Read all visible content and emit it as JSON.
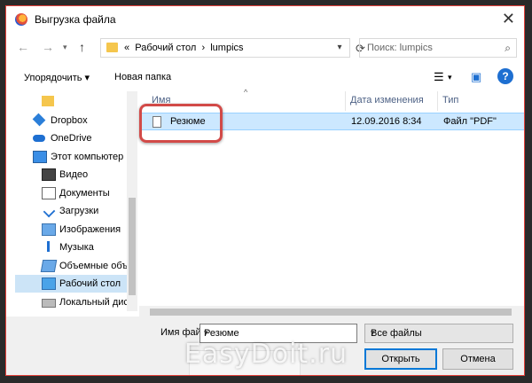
{
  "window": {
    "title": "Выгрузка файла",
    "close_glyph": "✕"
  },
  "address": {
    "path_prefix": "«",
    "crumbs": [
      "Рабочий стол",
      "lumpics"
    ],
    "separator": "›",
    "search_placeholder": "Поиск: lumpics"
  },
  "toolbar": {
    "organize_label": "Упорядочить ▾",
    "new_folder_label": "Новая папка",
    "help_glyph": "?"
  },
  "sidebar": {
    "items": [
      {
        "label": "",
        "icon": "folder-icon",
        "indent": 30
      },
      {
        "label": "Dropbox",
        "icon": "dropbox-icon",
        "indent": 20
      },
      {
        "label": "OneDrive",
        "icon": "onedrive-icon",
        "indent": 20
      },
      {
        "label": "Этот компьютер",
        "icon": "computer-icon",
        "indent": 20
      },
      {
        "label": "Видео",
        "icon": "video-icon",
        "indent": 30
      },
      {
        "label": "Документы",
        "icon": "documents-icon",
        "indent": 30
      },
      {
        "label": "Загрузки",
        "icon": "downloads-icon",
        "indent": 30
      },
      {
        "label": "Изображения",
        "icon": "pictures-icon",
        "indent": 30
      },
      {
        "label": "Музыка",
        "icon": "music-icon",
        "indent": 30
      },
      {
        "label": "Объемные объ",
        "icon": "3d-objects-icon",
        "indent": 30
      },
      {
        "label": "Рабочий стол",
        "icon": "desktop-icon",
        "indent": 30,
        "selected": true
      },
      {
        "label": "Локальный дис",
        "icon": "disk-icon",
        "indent": 30
      }
    ]
  },
  "file_list": {
    "columns": [
      "Имя",
      "Дата изменения",
      "Тип"
    ],
    "rows": [
      {
        "name": "Резюме",
        "modified": "12.09.2016 8:34",
        "type": "Файл \"PDF\""
      }
    ]
  },
  "footer": {
    "filename_label": "Имя файла:",
    "filename_value": "Резюме",
    "filetype_value": "Все файлы",
    "open_label": "Открыть",
    "cancel_label": "Отмена",
    "watermark": "EasyDoit.ru"
  }
}
